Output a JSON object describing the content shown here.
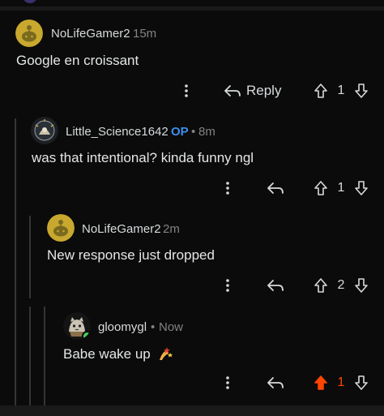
{
  "comments": [
    {
      "username": "NoLifeGamer2",
      "time": "15m",
      "text": "Google en croissant",
      "votes": "1",
      "reply_label": "Reply",
      "op_badge": ""
    },
    {
      "username": "Little_Science1642",
      "op_badge": "OP",
      "time": "8m",
      "text": "was that intentional? kinda funny ngl",
      "votes": "1"
    },
    {
      "username": "NoLifeGamer2",
      "time": "2m",
      "text": "New response just dropped",
      "votes": "2"
    },
    {
      "username": "gloomygl",
      "time": "Now",
      "text": "Babe wake up",
      "votes": "1",
      "upvoted": true
    }
  ],
  "separator": "•",
  "colors": {
    "background": "#0b0b0b",
    "text": "#d7dadc",
    "muted": "#818384",
    "op_blue": "#3d8ff0",
    "upvote_orange": "#ff4500",
    "thread_line": "#343536",
    "snoo_yellow": "#c8a82e",
    "online_green": "#46d160"
  },
  "icons": [
    "more-vertical-icon",
    "reply-arrow-icon",
    "upvote-icon",
    "downvote-icon",
    "sparkle-emoji-icon"
  ]
}
